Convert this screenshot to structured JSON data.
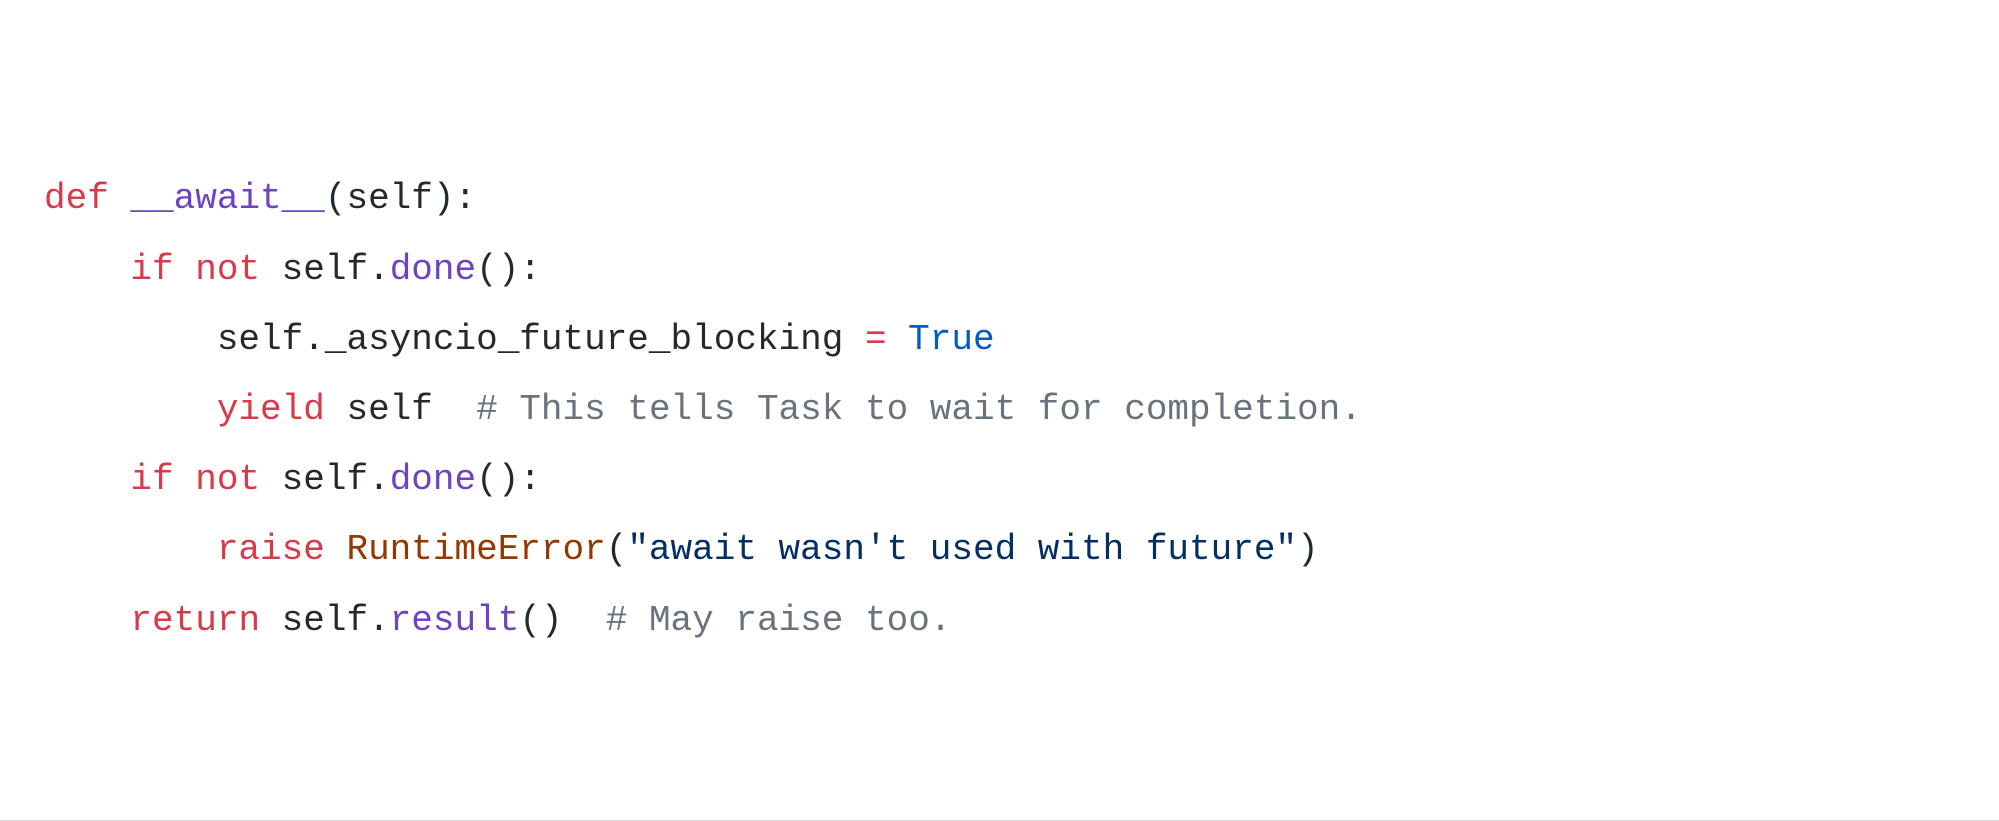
{
  "code": {
    "l1": {
      "def": "def",
      "name": "__await__",
      "lp": "(",
      "self": "self",
      "rp_colon": "):"
    },
    "l2": {
      "if": "if",
      "not": "not",
      "self": "self",
      "dot": ".",
      "done": "done",
      "call": "():"
    },
    "l3": {
      "self": "self",
      "dot": ".",
      "attr": "_asyncio_future_blocking",
      "eq": " = ",
      "true": "True"
    },
    "l4": {
      "yield": "yield",
      "self": "self",
      "comment": "# This tells Task to wait for completion."
    },
    "l5": {
      "if": "if",
      "not": "not",
      "self": "self",
      "dot": ".",
      "done": "done",
      "call": "():"
    },
    "l6": {
      "raise": "raise",
      "err": "RuntimeError",
      "lp": "(",
      "str": "\"await wasn't used with future\"",
      "rp": ")"
    },
    "l7": {
      "return": "return",
      "self": "self",
      "dot": ".",
      "result": "result",
      "call": "()",
      "comment": "# May raise too."
    }
  },
  "indent": {
    "i1": "    ",
    "i2": "        "
  }
}
